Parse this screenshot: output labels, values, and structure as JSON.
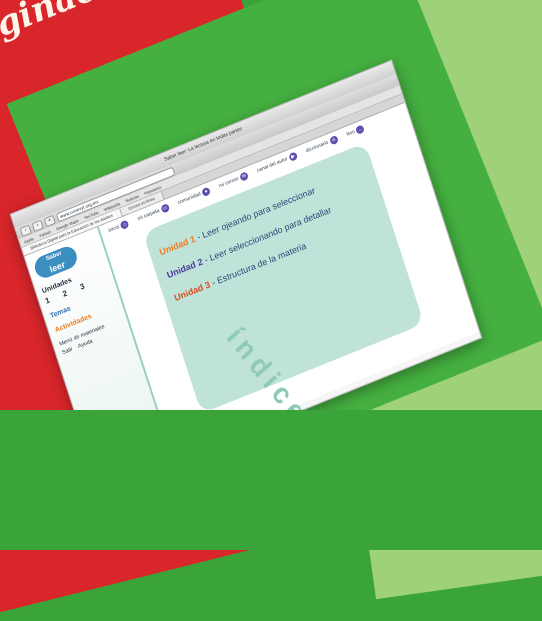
{
  "background": {
    "book_title_partial": "ginac",
    "colors": {
      "red": "#d8262b",
      "green": "#3aa33a",
      "teal": "#bfe3d8"
    }
  },
  "browser": {
    "window_title": "Saber leer: La lectura en todas partes",
    "url": "www.conevyt.org.mx",
    "bookmarks": [
      "Apple",
      "Yahoo!",
      "Google Maps",
      "YouTube",
      "Wikipedia",
      "Noticias",
      "Populares"
    ],
    "tabs": [
      "Biblioteca Digital para la Educación de los Adultos",
      "Cursos en línea"
    ]
  },
  "sidebar": {
    "logo_top": "Saber",
    "logo_bottom": "leer",
    "unidades_label": "Unidades",
    "unit_numbers": [
      "1",
      "2",
      "3"
    ],
    "temas_label": "Temas",
    "actividades_label": "Actividades",
    "menu_materiales": "Menú de materiales",
    "salir_label": "Salir",
    "ayuda_label": "Ayuda"
  },
  "topnav": [
    {
      "label": "inicio",
      "icon": "home-icon"
    },
    {
      "label": "mi carpeta",
      "icon": "folder-icon"
    },
    {
      "label": "comunidad",
      "icon": "community-icon"
    },
    {
      "label": "mi correo",
      "icon": "mail-icon"
    },
    {
      "label": "canal del autor",
      "icon": "channel-icon"
    },
    {
      "label": "diccionario",
      "icon": "dictionary-icon"
    },
    {
      "label": "foro",
      "icon": "forum-icon"
    }
  ],
  "units": [
    {
      "label": "Unidad 1",
      "text": "Leer ojeando para seleccionar"
    },
    {
      "label": "Unidad 2",
      "text": "Leer seleccionando para detallar"
    },
    {
      "label": "Unidad 3",
      "text": "Estructura de la materia"
    }
  ],
  "indice_word": "índice"
}
